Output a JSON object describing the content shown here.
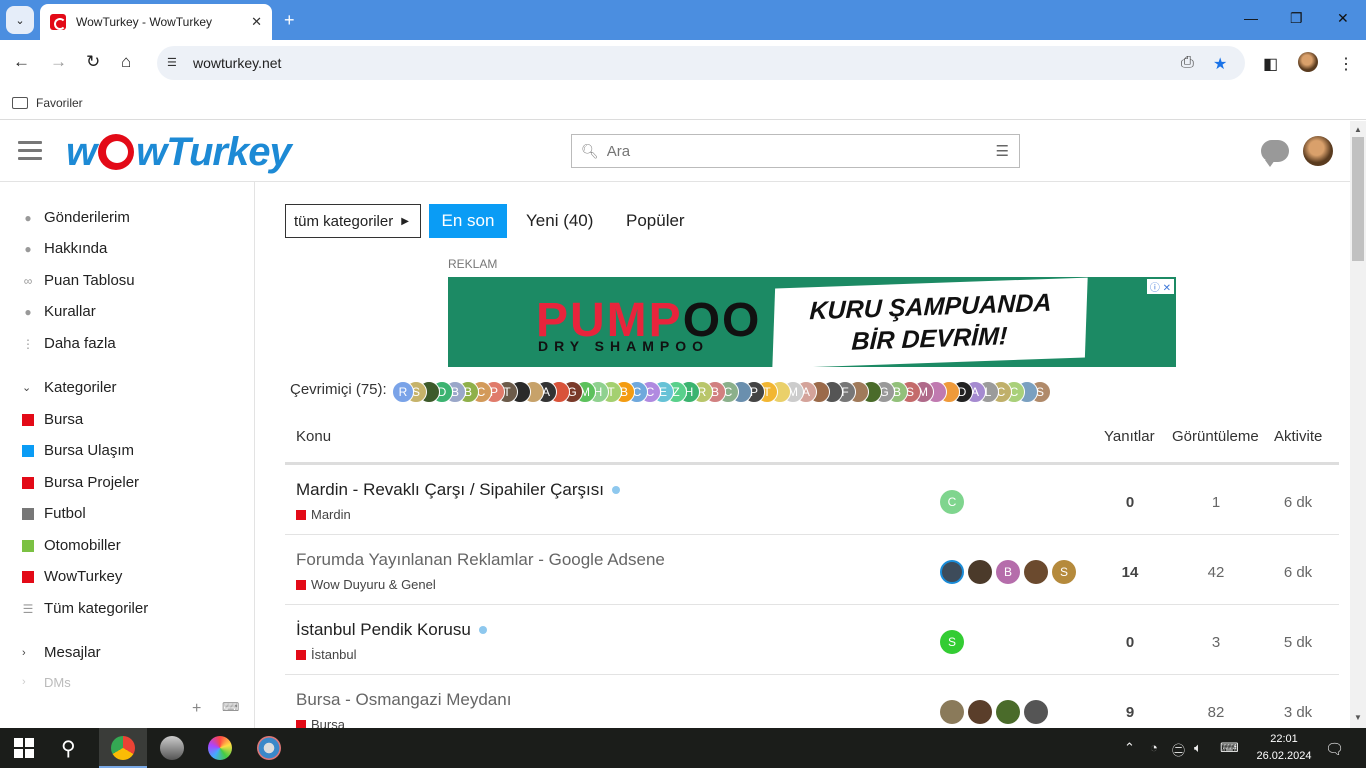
{
  "browser": {
    "tab_title": "WowTurkey - WowTurkey",
    "url": "wowturkey.net",
    "bookmark_folder": "Favoriler"
  },
  "site": {
    "logo_text_left": "w",
    "logo_text_right": "wTurkey",
    "search_placeholder": "Ara"
  },
  "sidebar": {
    "items": [
      {
        "label": "Gönderilerim",
        "icon": "user-icon"
      },
      {
        "label": "Hakkında",
        "icon": "info-icon"
      },
      {
        "label": "Puan Tablosu",
        "icon": "link-icon"
      },
      {
        "label": "Kurallar",
        "icon": "question-icon"
      },
      {
        "label": "Daha fazla",
        "icon": "more-vertical-icon"
      }
    ],
    "categories_header": "Kategoriler",
    "categories": [
      {
        "label": "Bursa",
        "color": "#e30a17"
      },
      {
        "label": "Bursa Ulaşım",
        "color": "#0a9cf5"
      },
      {
        "label": "Bursa Projeler",
        "color": "#e30a17"
      },
      {
        "label": "Futbol",
        "color": "#777777"
      },
      {
        "label": "Otomobiller",
        "color": "#7bc143"
      },
      {
        "label": "WowTurkey",
        "color": "#e30a17"
      }
    ],
    "all_categories": "Tüm kategoriler",
    "messages_header": "Mesajlar",
    "dms": "DMs"
  },
  "filters": {
    "category_dropdown": "tüm kategoriler",
    "tab_latest": "En son",
    "tab_new": "Yeni (40)",
    "tab_popular": "Popüler"
  },
  "ad": {
    "label": "REKLAM",
    "brand_red": "PUMP",
    "brand_black": "OO",
    "brand_sub": "DRY SHAMPOO",
    "slogan_1": "KURU ŞAMPUANDA",
    "slogan_2": "BİR DEVRİM!"
  },
  "online": {
    "label": "Çevrimiçi (75):",
    "avatars": [
      "R",
      "S",
      "",
      "D",
      "B",
      "B",
      "C",
      "P",
      "T",
      "",
      "",
      "A",
      "",
      "G",
      "M",
      "H",
      "T",
      "B",
      "C",
      "C",
      "E",
      "Z",
      "H",
      "R",
      "B",
      "C",
      "",
      "P",
      "T",
      "",
      "M",
      "A",
      "",
      "",
      "F",
      "",
      "",
      "G",
      "B",
      "S",
      "M",
      "",
      "",
      "D",
      "A",
      "L",
      "C",
      "C",
      "",
      "S"
    ]
  },
  "table": {
    "col_topic": "Konu",
    "col_replies": "Yanıtlar",
    "col_views": "Görüntüleme",
    "col_activity": "Aktivite",
    "rows": [
      {
        "title": "Mardin - Revaklı Çarşı / Sipahiler Çarşısı",
        "category": "Mardin",
        "replies": "0",
        "views": "1",
        "activity": "6 dk",
        "unread": true
      },
      {
        "title": "Forumda Yayınlanan Reklamlar - Google Adsene",
        "category": "Wow Duyuru & Genel",
        "replies": "14",
        "views": "42",
        "activity": "6 dk",
        "unread": false
      },
      {
        "title": "İstanbul Pendik Korusu",
        "category": "İstanbul",
        "replies": "0",
        "views": "3",
        "activity": "5 dk",
        "unread": true
      },
      {
        "title": "Bursa - Osmangazi Meydanı",
        "category": "Bursa",
        "replies": "9",
        "views": "82",
        "activity": "3 dk",
        "unread": false
      }
    ],
    "row_posters": [
      [
        "C"
      ],
      [
        "",
        "",
        "B",
        "",
        "S"
      ],
      [
        "S"
      ],
      [
        "",
        "",
        "",
        ""
      ]
    ]
  },
  "taskbar": {
    "time": "22:01",
    "date": "26.02.2024"
  }
}
